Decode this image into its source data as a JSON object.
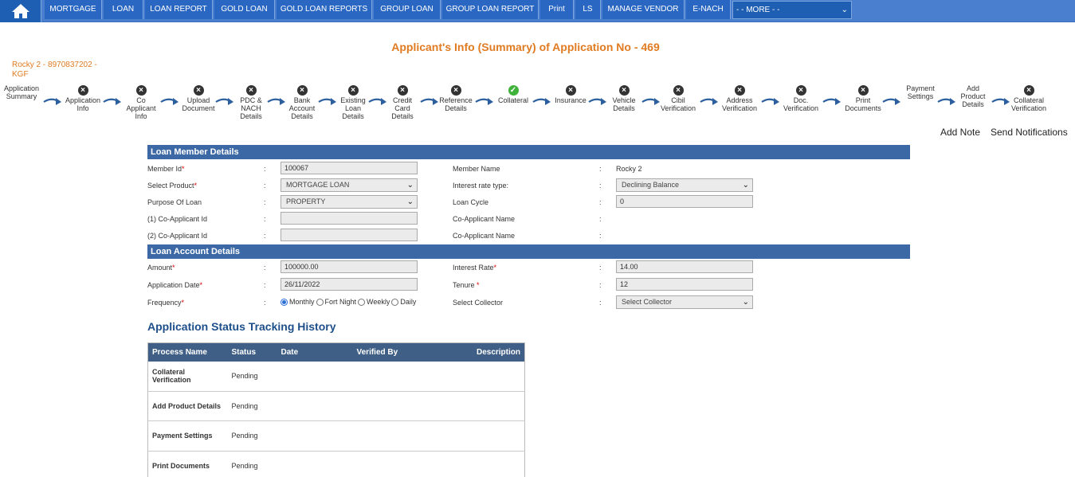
{
  "nav": {
    "items": [
      "MORTGAGE",
      "LOAN",
      "LOAN REPORT",
      "GOLD LOAN",
      "GOLD LOAN REPORTS",
      "GROUP LOAN",
      "GROUP LOAN REPORT",
      "Print",
      "LS",
      "MANAGE VENDOR",
      "E-NACH"
    ],
    "more": "- - MORE - -"
  },
  "page": {
    "title": "Applicant's Info (Summary) of Application No - 469",
    "applicant": "Rocky 2 - 8970837202 - KGF"
  },
  "steps": [
    {
      "label": "Application Summary",
      "status": "none"
    },
    {
      "label": "Application Info",
      "status": "x"
    },
    {
      "label": "Co Applicant Info",
      "status": "x"
    },
    {
      "label": "Upload Document",
      "status": "x"
    },
    {
      "label": "PDC & NACH Details",
      "status": "x"
    },
    {
      "label": "Bank Account Details",
      "status": "x"
    },
    {
      "label": "Existing Loan Details",
      "status": "x"
    },
    {
      "label": "Credit Card Details",
      "status": "x"
    },
    {
      "label": "Reference Details",
      "status": "x"
    },
    {
      "label": "Collateral",
      "status": "ok"
    },
    {
      "label": "Insurance",
      "status": "x"
    },
    {
      "label": "Vehicle Details",
      "status": "x"
    },
    {
      "label": "Cibil Verification",
      "status": "x"
    },
    {
      "label": "Address Verification",
      "status": "x"
    },
    {
      "label": "Doc. Verification",
      "status": "x"
    },
    {
      "label": "Print Documents",
      "status": "x"
    },
    {
      "label": "Payment Settings",
      "status": "none"
    },
    {
      "label": "Add Product Details",
      "status": "none"
    },
    {
      "label": "Collateral Verification",
      "status": "x"
    }
  ],
  "actions": {
    "add_note": "Add Note",
    "send_notifications": "Send Notifications"
  },
  "member": {
    "header": "Loan Member Details",
    "member_id_label": "Member Id",
    "member_id": "100067",
    "member_name_label": "Member Name",
    "member_name": "Rocky 2",
    "product_label": "Select Product",
    "product": "MORTGAGE LOAN",
    "rate_type_label": "Interest rate type:",
    "rate_type": "Declining Balance",
    "purpose_label": "Purpose Of Loan",
    "purpose": "PROPERTY",
    "cycle_label": "Loan Cycle",
    "cycle": "0",
    "co1_label": "(1) Co-Applicant Id",
    "co1_name_label": "Co-Applicant Name",
    "co2_label": "(2) Co-Applicant Id",
    "co2_name_label": "Co-Applicant Name"
  },
  "account": {
    "header": "Loan Account Details",
    "amount_label": "Amount",
    "amount": "100000.00",
    "rate_label": "Interest Rate",
    "rate": "14.00",
    "app_date_label": "Application Date",
    "app_date": "26/11/2022",
    "tenure_label": "Tenure ",
    "tenure": "12",
    "frequency_label": "Frequency",
    "freq_options": [
      "Monthly",
      "Fort Night",
      "Weekly",
      "Daily"
    ],
    "collector_label": "Select Collector",
    "collector": "Select Collector"
  },
  "history": {
    "title": "Application Status Tracking History",
    "columns": [
      "Process Name",
      "Status",
      "Date",
      "Verified By",
      "Description"
    ],
    "rows": [
      [
        "Collateral Verification",
        "Pending",
        "",
        "",
        ""
      ],
      [
        "Add Product Details",
        "Pending",
        "",
        "",
        ""
      ],
      [
        "Payment Settings",
        "Pending",
        "",
        "",
        ""
      ],
      [
        "Print Documents",
        "Pending",
        "",
        "",
        ""
      ]
    ]
  }
}
